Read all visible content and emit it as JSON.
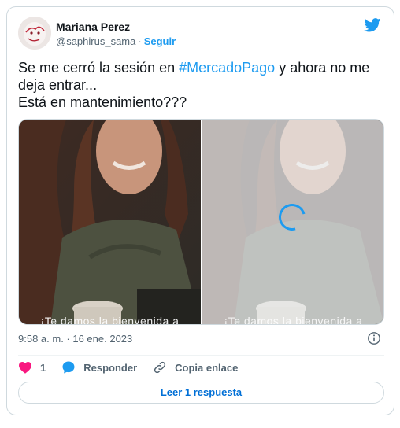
{
  "author": {
    "name": "Mariana Perez",
    "handle": "@saphirus_sama",
    "separator": "·",
    "follow_label": "Seguir"
  },
  "tweet": {
    "line1_prefix": "Se me cerró la sesión en ",
    "hashtag": "#MercadoPago",
    "line1_suffix": " y ahora no me deja entrar...",
    "line2": "Está en mantenimiento???"
  },
  "media": {
    "left_caption": "¡Te damos la bienvenida a",
    "right_caption": "¡Te damos la bienvenida a"
  },
  "meta": {
    "timestamp": "9:58 a. m. · 16 ene. 2023"
  },
  "actions": {
    "like_count": "1",
    "reply_label": "Responder",
    "copy_label": "Copia enlace"
  },
  "footer": {
    "read_replies_label": "Leer 1 respuesta"
  },
  "colors": {
    "accent": "#1d9bf0",
    "like": "#f91880",
    "muted": "#536471"
  },
  "icons": [
    "twitter-bird-icon",
    "info-icon",
    "heart-icon",
    "reply-bubble-icon",
    "link-icon",
    "loading-spinner-icon"
  ]
}
